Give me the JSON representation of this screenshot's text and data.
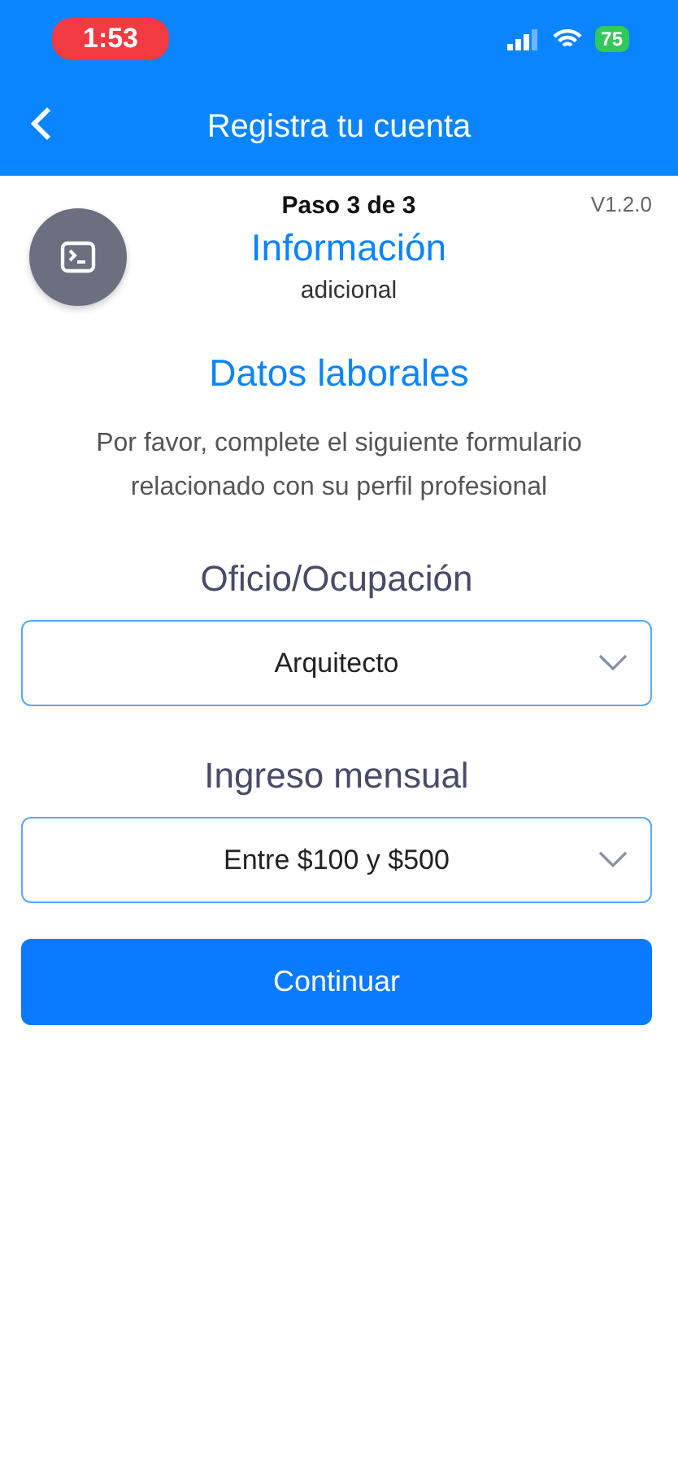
{
  "status_bar": {
    "time": "1:53",
    "battery": "75"
  },
  "nav": {
    "title": "Registra tu cuenta"
  },
  "step": {
    "progress": "Paso 3 de 3",
    "title": "Información",
    "subtitle": "adicional",
    "version": "V1.2.0"
  },
  "section": {
    "title": "Datos laborales",
    "description": "Por favor, complete el siguiente formulario relacionado con su perfil profesional"
  },
  "fields": [
    {
      "label": "Oficio/Ocupación",
      "value": "Arquitecto"
    },
    {
      "label": "Ingreso mensual",
      "value": "Entre $100 y $500"
    }
  ],
  "buttons": [
    "Continuar"
  ]
}
